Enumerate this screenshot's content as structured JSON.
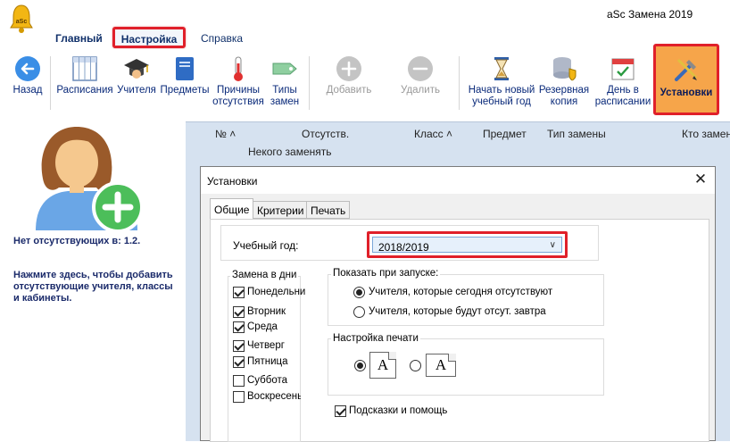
{
  "app": {
    "title": "aSc Замена 2019"
  },
  "ribbon": {
    "tabs": [
      "Главный",
      "Настройка",
      "Справка"
    ]
  },
  "toolbar": {
    "back": "Назад",
    "timetables": "Расписания",
    "teachers": "Учителя",
    "subjects": "Предметы",
    "reasons": [
      "Причины",
      "отсутствия"
    ],
    "types": [
      "Типы",
      "замен"
    ],
    "add": "Добавить",
    "remove": "Удалить",
    "new_year": [
      "Начать новый",
      "учебный год"
    ],
    "backup": [
      "Резервная",
      "копия"
    ],
    "day_in_tt": [
      "День в",
      "расписании"
    ],
    "settings": "Установки"
  },
  "left_panel": {
    "no_absent": "Нет отсутствующих в: 1.2.",
    "hint": "Нажмите здесь, чтобы добавить отсутствующие учителя, классы и кабинеты."
  },
  "table": {
    "columns": [
      "№ ˄",
      "Отсутств.",
      "Класс ˄",
      "Предмет",
      "Тип замены",
      "Кто замен"
    ],
    "row_nobody": "Некого заменять"
  },
  "dialog": {
    "title": "Установки",
    "close": "✕",
    "tabs": [
      "Общие",
      "Критерии",
      "Печать"
    ],
    "year_label": "Учебный год:",
    "year_value": "2018/2019",
    "days_group": {
      "title": "Замена в дни",
      "days": [
        {
          "label": "Понедельни",
          "checked": true
        },
        {
          "label": "Вторник",
          "checked": true
        },
        {
          "label": "Среда",
          "checked": true
        },
        {
          "label": "Четверг",
          "checked": true
        },
        {
          "label": "Пятница",
          "checked": true
        },
        {
          "label": "Суббота",
          "checked": false
        },
        {
          "label": "Воскресенье",
          "checked": false
        }
      ]
    },
    "startup_group": {
      "title": "Показать при запуске:",
      "options": [
        {
          "label": "Учителя, которые сегодня отсутствуют",
          "selected": true
        },
        {
          "label": "Учителя, которые будут отсут. завтра",
          "selected": false
        }
      ]
    },
    "print_group": {
      "title": "Настройка печати",
      "portrait_selected": true
    },
    "hints": {
      "label": "Подсказки и помощь",
      "checked": true
    }
  }
}
